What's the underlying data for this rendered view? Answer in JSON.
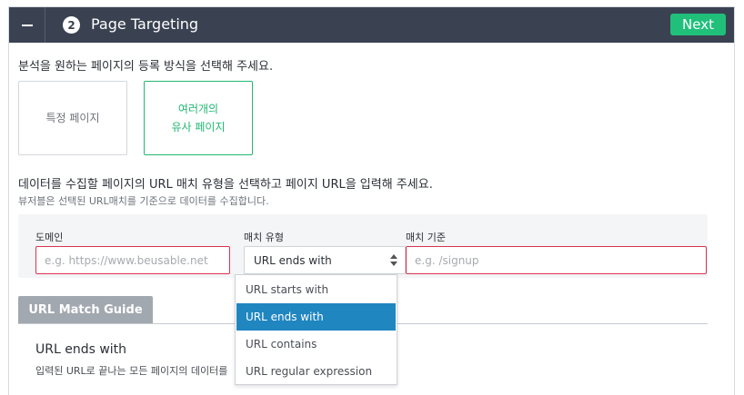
{
  "header": {
    "collapse_icon": "minus-icon",
    "step_number": "2",
    "title": "Page Targeting",
    "next_label": "Next",
    "colors": {
      "bar": "#3a4252",
      "next": "#20c07a"
    }
  },
  "targeting": {
    "question": "분석을 원하는 페이지의 등록 방식을 선택해 주세요.",
    "options": [
      {
        "label": "특정 페이지",
        "selected": false
      },
      {
        "label_line1": "여러개의",
        "label_line2": "유사 페이지",
        "selected": true
      }
    ],
    "accent_color": "#22b773"
  },
  "url_section": {
    "title": "데이터를 수집할 페이지의 URL 매치 유형을 선택하고 페이지 URL을 입력해 주세요.",
    "subtitle": "뷰저블은 선택된 URL매치를 기준으로 데이터를 수집합니다.",
    "domain": {
      "label": "도메인",
      "placeholder": "e.g. https://www.beusable.net",
      "value": ""
    },
    "match_type": {
      "label": "매치 유형",
      "selected": "URL ends with",
      "options": [
        "URL starts with",
        "URL ends with",
        "URL contains",
        "URL regular expression"
      ],
      "selected_index": 1
    },
    "match_value": {
      "label": "매치 기준",
      "placeholder": "e.g. /signup",
      "value": ""
    },
    "error_border_color": "#d9334f",
    "selected_option_color": "#1f86c0"
  },
  "guide": {
    "tab_label": "URL Match Guide",
    "title": "URL ends with",
    "description": "입력된 URL로 끝나는 모든 페이지의 데이터를"
  }
}
